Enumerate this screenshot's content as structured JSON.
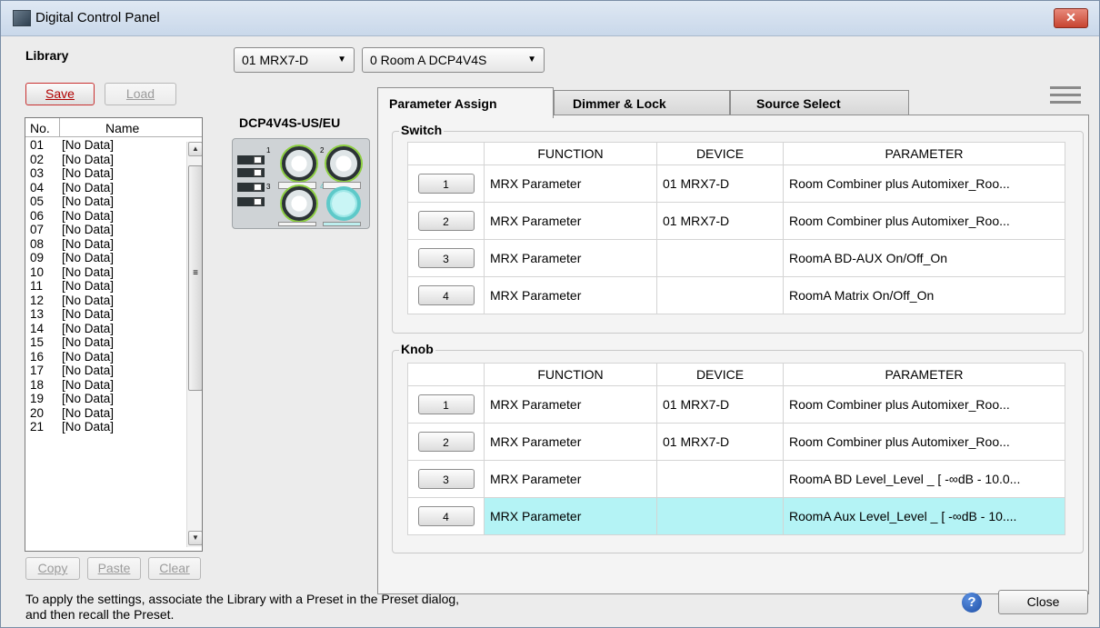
{
  "window": {
    "title": "Digital Control Panel",
    "close_glyph": "✕"
  },
  "library": {
    "label": "Library",
    "save_label": "Save",
    "load_label": "Load",
    "columns": {
      "no": "No.",
      "name": "Name"
    },
    "rows": [
      {
        "no": "01",
        "name": "[No Data]"
      },
      {
        "no": "02",
        "name": "[No Data]"
      },
      {
        "no": "03",
        "name": "[No Data]"
      },
      {
        "no": "04",
        "name": "[No Data]"
      },
      {
        "no": "05",
        "name": "[No Data]"
      },
      {
        "no": "06",
        "name": "[No Data]"
      },
      {
        "no": "07",
        "name": "[No Data]"
      },
      {
        "no": "08",
        "name": "[No Data]"
      },
      {
        "no": "09",
        "name": "[No Data]"
      },
      {
        "no": "10",
        "name": "[No Data]"
      },
      {
        "no": "11",
        "name": "[No Data]"
      },
      {
        "no": "12",
        "name": "[No Data]"
      },
      {
        "no": "13",
        "name": "[No Data]"
      },
      {
        "no": "14",
        "name": "[No Data]"
      },
      {
        "no": "15",
        "name": "[No Data]"
      },
      {
        "no": "16",
        "name": "[No Data]"
      },
      {
        "no": "17",
        "name": "[No Data]"
      },
      {
        "no": "18",
        "name": "[No Data]"
      },
      {
        "no": "19",
        "name": "[No Data]"
      },
      {
        "no": "20",
        "name": "[No Data]"
      },
      {
        "no": "21",
        "name": "[No Data]"
      }
    ],
    "copy_label": "Copy",
    "paste_label": "Paste",
    "clear_label": "Clear"
  },
  "selectors": {
    "device": "01 MRX7-D",
    "panel": "0 Room A DCP4V4S"
  },
  "device_model": "DCP4V4S-US/EU",
  "tabs": [
    {
      "label": "Parameter Assign",
      "active": true
    },
    {
      "label": "Dimmer & Lock",
      "active": false
    },
    {
      "label": "Source Select",
      "active": false
    }
  ],
  "switch_group": {
    "title": "Switch",
    "headers": {
      "function": "FUNCTION",
      "device": "DEVICE",
      "parameter": "PARAMETER"
    },
    "rows": [
      {
        "num": "1",
        "function": "MRX Parameter",
        "device": "01 MRX7-D",
        "parameter": "Room Combiner plus Automixer_Roo..."
      },
      {
        "num": "2",
        "function": "MRX Parameter",
        "device": "01 MRX7-D",
        "parameter": "Room Combiner plus Automixer_Roo..."
      },
      {
        "num": "3",
        "function": "MRX Parameter",
        "device": "",
        "parameter": "RoomA BD-AUX On/Off_On"
      },
      {
        "num": "4",
        "function": "MRX Parameter",
        "device": "",
        "parameter": "RoomA Matrix On/Off_On"
      }
    ]
  },
  "knob_group": {
    "title": "Knob",
    "headers": {
      "function": "FUNCTION",
      "device": "DEVICE",
      "parameter": "PARAMETER"
    },
    "rows": [
      {
        "num": "1",
        "function": "MRX Parameter",
        "device": "01 MRX7-D",
        "parameter": "Room Combiner plus Automixer_Roo..."
      },
      {
        "num": "2",
        "function": "MRX Parameter",
        "device": "01 MRX7-D",
        "parameter": "Room Combiner plus Automixer_Roo..."
      },
      {
        "num": "3",
        "function": "MRX Parameter",
        "device": "",
        "parameter": "RoomA BD Level_Level _ [ -∞dB - 10.0..."
      },
      {
        "num": "4",
        "function": "MRX Parameter",
        "device": "",
        "parameter": "RoomA Aux Level_Level _ [ -∞dB - 10...."
      }
    ]
  },
  "footer": {
    "line1": "To apply the settings, associate the Library with a Preset in the Preset dialog,",
    "line2": "and then recall the Preset.",
    "help_glyph": "?",
    "close_label": "Close"
  },
  "panel_labels": {
    "sw1": "1",
    "sw2": "2",
    "sw3": "3",
    "sw4": "4",
    "k2": "2",
    "k3": "3",
    "k4": "4"
  },
  "icons": {
    "app": "app-icon",
    "help": "help-icon",
    "menu": "hamburger-menu-icon",
    "dropdown": "chevron-down-icon"
  }
}
